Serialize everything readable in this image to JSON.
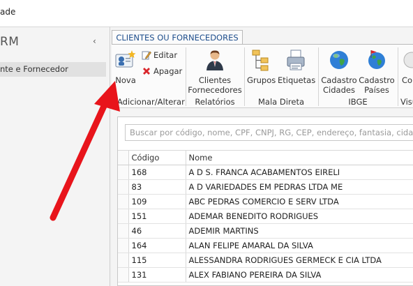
{
  "window": {
    "title_fragment": "ade"
  },
  "sidebar": {
    "title": "RM",
    "collapse_glyph": "‹",
    "items": [
      {
        "label": "nte e Fornecedor"
      }
    ]
  },
  "tab": {
    "label": "CLIENTES OU FORNECEDORES"
  },
  "ribbon": {
    "buttons": {
      "nova": "Nova",
      "editar": "Editar",
      "apagar": "Apagar",
      "clientes_line1": "Clientes",
      "clientes_line2": "Fornecedores",
      "grupos": "Grupos",
      "etiquetas": "Etiquetas",
      "cad_cidades_line1": "Cadastro",
      "cad_cidades_line2": "Cidades",
      "cad_paises_line1": "Cadastro",
      "cad_paises_line2": "Países",
      "cut_button": "Co"
    },
    "groups": {
      "adicionar": "Adicionar/Alterar",
      "relatorios": "Relatórios",
      "mala_direta": "Mala Direta",
      "ibge": "IBGE",
      "cut_group": "Visu"
    },
    "icons": [
      "user-add-icon",
      "edit-icon",
      "delete-icon",
      "person-icon",
      "group-icon",
      "printer-icon",
      "globe-icon",
      "globe-flag-icon"
    ]
  },
  "search": {
    "placeholder": "Buscar por código, nome, CPF, CNPJ, RG, CEP, endereço, fantasia, cidade, bairro"
  },
  "table": {
    "headers": {
      "code": "Código",
      "name": "Nome"
    },
    "rows": [
      {
        "code": "168",
        "name": "A D S. FRANCA ACABAMENTOS EIRELI"
      },
      {
        "code": "83",
        "name": "A D VARIEDADES EM PEDRAS LTDA ME"
      },
      {
        "code": "109",
        "name": "ABC PEDRAS COMERCIO E SERV LTDA"
      },
      {
        "code": "151",
        "name": "ADEMAR BENEDITO RODRIGUES"
      },
      {
        "code": "46",
        "name": "ADEMIR MARTINS"
      },
      {
        "code": "164",
        "name": "ALAN FELIPE AMARAL DA SILVA"
      },
      {
        "code": "115",
        "name": "ALESSANDRA RODRIGUES GERMECK E CIA LTDA"
      },
      {
        "code": "131",
        "name": "ALEX FABIANO PEREIRA DA SILVA"
      }
    ]
  },
  "colors": {
    "tab_text": "#1e4e8c",
    "arrow": "#e8141b",
    "selected_item": "#e1e1e1"
  }
}
